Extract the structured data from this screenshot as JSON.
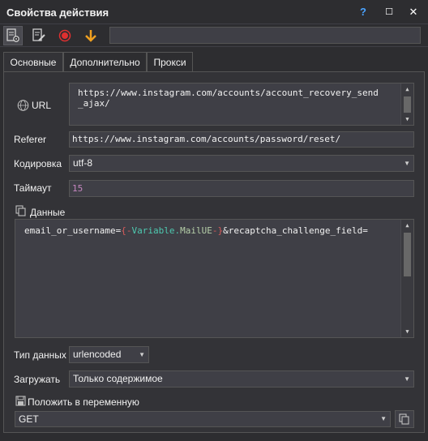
{
  "window": {
    "title": "Свойства действия",
    "help_label": "?",
    "maximize_label": "☐",
    "close_label": "✕"
  },
  "toolbar": {
    "icons": [
      "settings-page-icon",
      "edit-page-icon",
      "record-icon",
      "download-arrow-icon"
    ],
    "search_value": ""
  },
  "tabs": [
    {
      "label": "Основные",
      "selected": true
    },
    {
      "label": "Дополнительно",
      "selected": false
    },
    {
      "label": "Прокси",
      "selected": false
    }
  ],
  "form": {
    "url_label": "URL",
    "url_line1": "https://www.instagram.com/accounts/account_recovery_send",
    "url_line2": "_ajax/",
    "referer_label": "Referer",
    "referer_value": "https://www.instagram.com/accounts/password/reset/",
    "encoding_label": "Кодировка",
    "encoding_value": "utf-8",
    "timeout_label": "Таймаут",
    "timeout_value": "15",
    "data_label": "Данные",
    "data": {
      "part1": "email_or_username=",
      "brace_open": "{-",
      "var_prefix": "Variable.",
      "var_name": "MailUE",
      "brace_close": "-}",
      "part2": "&recaptcha_challenge_field="
    },
    "datatype_label": "Тип данных",
    "datatype_value": "urlencoded",
    "load_label": "Загружать",
    "load_value": "Только содержимое",
    "save_label": "Положить в переменную",
    "method_value": "GET"
  },
  "colors": {
    "background": "#2d2d30",
    "field": "#3f3f46",
    "record": "#e03030",
    "download": "#f0a020"
  }
}
